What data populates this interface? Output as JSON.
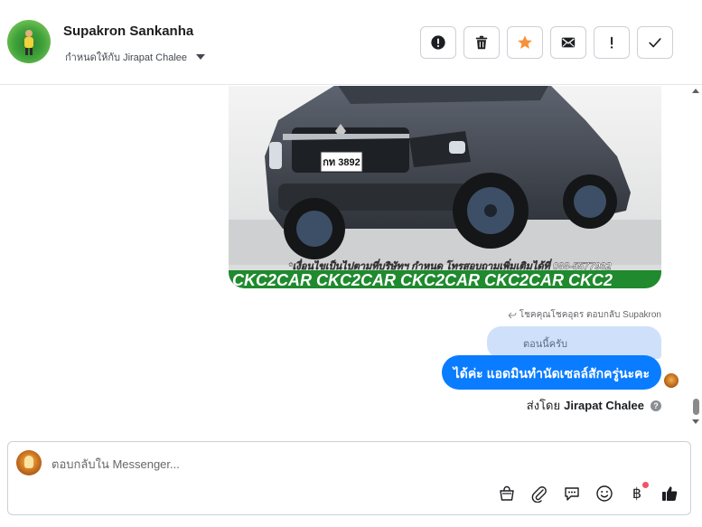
{
  "header": {
    "contact_name": "Supakron Sankanha",
    "assign_label": "กำหนดให้กับ Jirapat Chalee",
    "actions": [
      {
        "name": "follow-up-button",
        "icon": "alert-circle-icon"
      },
      {
        "name": "delete-button",
        "icon": "trash-icon"
      },
      {
        "name": "star-button",
        "icon": "star-icon"
      },
      {
        "name": "mark-unread-button",
        "icon": "envelope-icon"
      },
      {
        "name": "important-button",
        "icon": "exclamation-icon"
      },
      {
        "name": "done-button",
        "icon": "check-icon"
      }
    ],
    "star_color": "#f7923a"
  },
  "conversation": {
    "image_message": {
      "plate": "กท 3892",
      "caption": "*เงื่อนไขเป็นไปตามที่บริษัทฯ กำหนด โทรสอบถามเพิ่มเติมได้ที่ 088-5577932",
      "banner": "CKC2CAR CKC2CAR CKC2CAR CKC2CAR CKC2"
    },
    "reply_note": "โชคคุณโชคอุดร ตอบกลับ Supakron",
    "quoted_text": "ตอนนี้ครับ",
    "bubble_text": "ได้ค่ะ แอดมินทำนัดเซลล์สักครู่นะคะ",
    "sent_by_prefix": "ส่งโดย",
    "sent_by_name": "Jirapat Chalee",
    "bubble_color": "#0a7cff"
  },
  "composer": {
    "placeholder": "ตอบกลับใน Messenger...",
    "tools": [
      "shopping-bag-icon",
      "paperclip-icon",
      "saved-reply-icon",
      "emoji-icon",
      "baht-icon",
      "thumbs-up-icon"
    ],
    "baht_symbol": "฿"
  }
}
